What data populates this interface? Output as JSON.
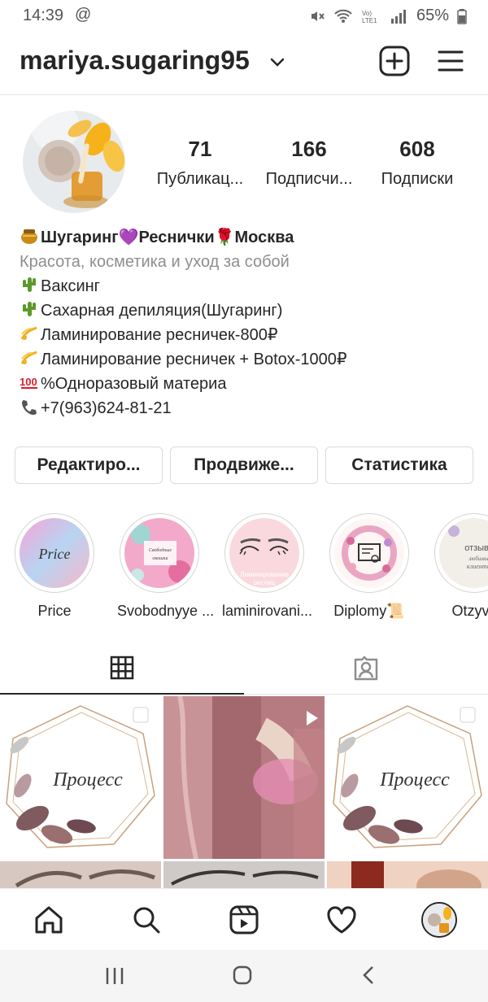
{
  "status_bar": {
    "time": "14:39",
    "at_symbol": "@",
    "battery": "65%"
  },
  "header": {
    "username": "mariya.sugaring95"
  },
  "profile": {
    "stats": [
      {
        "value": "71",
        "label": "Публикац..."
      },
      {
        "value": "166",
        "label": "Подписчи..."
      },
      {
        "value": "608",
        "label": "Подписки"
      }
    ],
    "bio": {
      "name": "Шугаринг💜Реснички🌹Москва",
      "category": "Красота, косметика и уход за собой",
      "lines": [
        "Ваксинг",
        "Сахарная депиляция(Шугаринг)",
        "Ламинирование ресничек-800₽",
        "Ламинирование ресничек + Botox-1000₽",
        "%Одноразовый материа",
        "+7(963)624-81-21"
      ]
    }
  },
  "buttons": {
    "edit": "Редактиро...",
    "promote": "Продвиже...",
    "stats": "Статистика"
  },
  "highlights": [
    {
      "label": "Price",
      "cover_text": "Price"
    },
    {
      "label": "Svobodnyye ...",
      "cover_text": "Свободные окошки"
    },
    {
      "label": "laminirovani...",
      "cover_text": "Ламинирование ресниц"
    },
    {
      "label": "Diplomy📜",
      "cover_text": ""
    },
    {
      "label": "Otzyvy",
      "cover_text": "отзывы любимых клиентов"
    }
  ],
  "tabs": [
    {
      "icon": "grid-icon",
      "active": true
    },
    {
      "icon": "tagged-icon",
      "active": false
    }
  ],
  "posts": [
    {
      "type": "image",
      "caption": "Процесс"
    },
    {
      "type": "video",
      "caption": ""
    },
    {
      "type": "image",
      "caption": "Процесс"
    }
  ],
  "bottom_nav": [
    "home-icon",
    "search-icon",
    "reels-icon",
    "activity-icon",
    "profile-icon"
  ],
  "colors": {
    "text": "#262626",
    "secondary": "#8e8e8e",
    "border": "#dbdbdb"
  }
}
